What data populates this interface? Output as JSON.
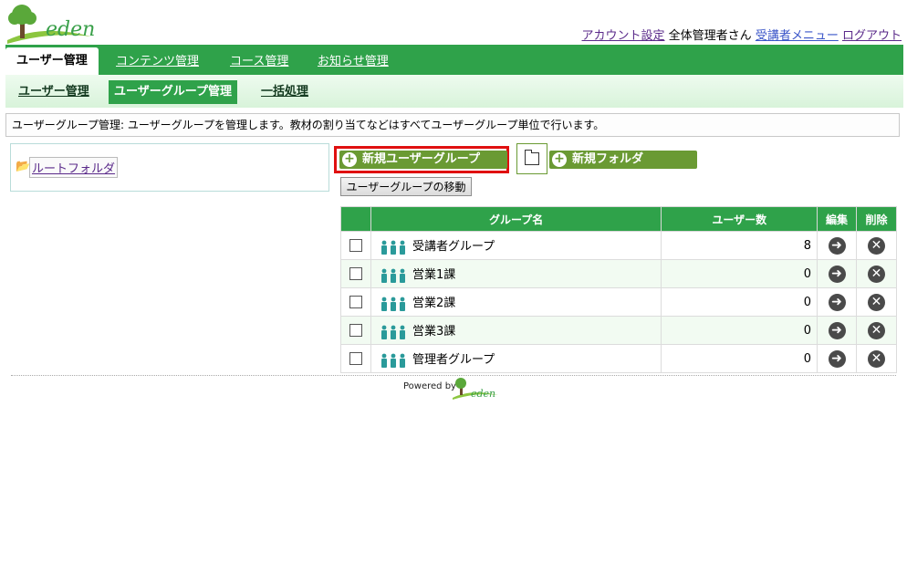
{
  "header": {
    "logo_text": "eden",
    "account_settings": "アカウント設定",
    "user_name": "全体管理者さん",
    "learner_menu": "受講者メニュー",
    "logout": "ログアウト"
  },
  "main_nav": [
    "ユーザー管理",
    "コンテンツ管理",
    "コース管理",
    "お知らせ管理"
  ],
  "sub_nav": [
    "ユーザー管理",
    "ユーザーグループ管理",
    "一括処理"
  ],
  "description": "ユーザーグループ管理: ユーザーグループを管理します。教材の割り当てなどはすべてユーザーグループ単位で行います。",
  "tree": {
    "root": "ルートフォルダ"
  },
  "buttons": {
    "new_group": "新規ユーザーグループ",
    "new_folder": "新規フォルダ",
    "move_group": "ユーザーグループの移動"
  },
  "table": {
    "headers": {
      "group_name": "グループ名",
      "user_count": "ユーザー数",
      "edit": "編集",
      "delete": "削除"
    },
    "rows": [
      {
        "name": "受講者グループ",
        "count": "8"
      },
      {
        "name": "営業1課",
        "count": "0"
      },
      {
        "name": "営業2課",
        "count": "0"
      },
      {
        "name": "営業3課",
        "count": "0"
      },
      {
        "name": "管理者グループ",
        "count": "0"
      }
    ]
  },
  "footer": {
    "powered": "Powered by",
    "logo_text": "eden"
  },
  "colors": {
    "brand_green": "#2fa24a",
    "button_green": "#6a9a33",
    "highlight_red": "#e01010"
  }
}
